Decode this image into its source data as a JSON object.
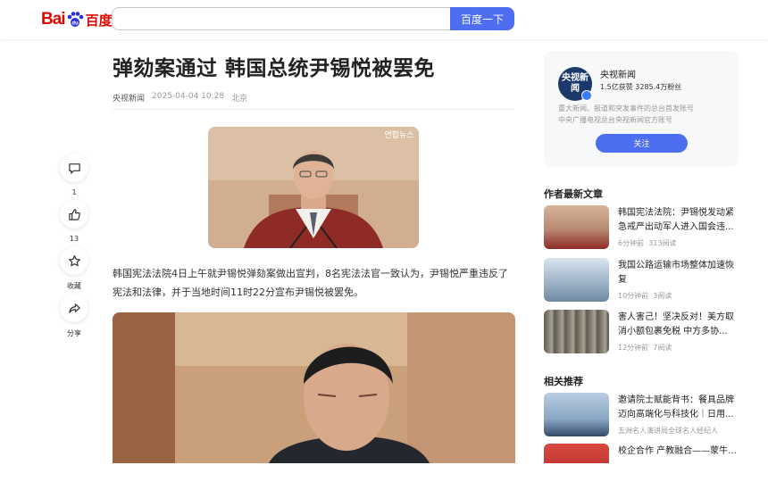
{
  "header": {
    "logo_bai": "Bai",
    "logo_du": "百度",
    "search_value": "",
    "search_button": "百度一下"
  },
  "article": {
    "title": "弹劾案通过 韩国总统尹锡悦被罢免",
    "source": "央视新闻",
    "date": "2025-04-04 10:28",
    "location": "北京",
    "image1_watermark": "연합뉴스",
    "paragraph": "韩国宪法法院4日上午就尹锡悦弹劾案做出宣判，8名宪法法官一致认为，尹锡悦严重违反了宪法和法律，并于当地时间11时22分宣布尹锡悦被罢免。"
  },
  "side_actions": [
    {
      "icon": "comment-icon",
      "label": "1"
    },
    {
      "icon": "thumbs-up-icon",
      "label": "13"
    },
    {
      "icon": "star-icon",
      "label": "收藏"
    },
    {
      "icon": "share-icon",
      "label": "分享"
    }
  ],
  "author_card": {
    "avatar_text": "央视新闻",
    "name": "央视新闻",
    "stats": "1.5亿获赞 3285.4万粉丝",
    "desc_line1": "重大新闻、报道和突发事件的总台首发账号",
    "desc_line2": "中央广播电视总台央视新闻官方账号",
    "follow_button": "关注"
  },
  "author_latest": {
    "heading": "作者最新文章",
    "items": [
      {
        "title": "韩国宪法法院：尹锡悦发动紧急戒严出动军人进入国会违...",
        "time": "6分钟前",
        "reads": "313阅读",
        "thumb": "#b98a73"
      },
      {
        "title": "我国公路运输市场整体加速恢复",
        "time": "10分钟前",
        "reads": "3阅读",
        "thumb": "#9fb4c8"
      },
      {
        "title": "害人害己！坚决反对！美方取消小额包裹免税 中方多协...",
        "time": "12分钟前",
        "reads": "7阅读",
        "thumb": "#7d7a6e"
      }
    ]
  },
  "related": {
    "heading": "相关推荐",
    "items": [
      {
        "title": "邀请院士赋能背书：餐具品牌迈向高端化与科技化｜日用...",
        "meta": "五洲名人演讲局全球名人经纪人",
        "thumb": "#8aa7c4"
      },
      {
        "title": "校企合作 产教融合——蒙牛...",
        "meta": "",
        "thumb": "#c43a34"
      }
    ]
  },
  "colors": {
    "brand_red": "#e10601",
    "brand_blue": "#4e6ef2",
    "card_bg": "#f7f8fa"
  }
}
